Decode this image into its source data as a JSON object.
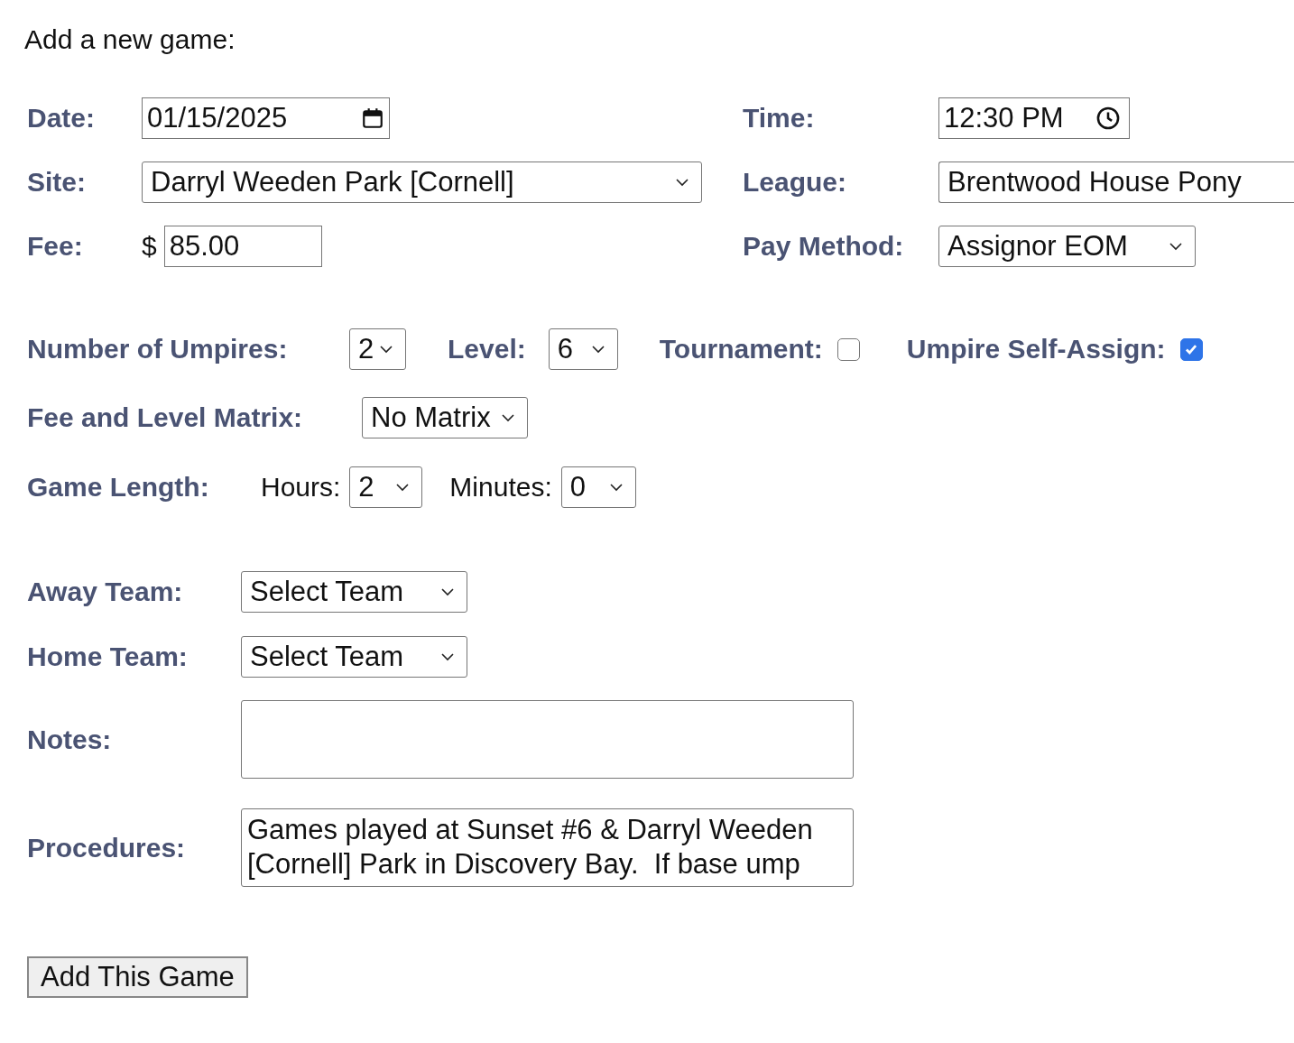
{
  "heading": "Add a new game:",
  "date": {
    "label": "Date:",
    "value": "01/15/2025"
  },
  "time": {
    "label": "Time:",
    "value": "12:30 PM"
  },
  "site": {
    "label": "Site:",
    "value": "Darryl Weeden Park [Cornell]"
  },
  "league": {
    "label": "League:",
    "value": "Brentwood House Pony"
  },
  "fee": {
    "label": "Fee:",
    "currency": "$",
    "value": "85.00"
  },
  "pay_method": {
    "label": "Pay Method:",
    "value": "Assignor EOM"
  },
  "umpires": {
    "label": "Number of Umpires:",
    "value": "2"
  },
  "level": {
    "label": "Level:",
    "value": "6"
  },
  "tournament": {
    "label": "Tournament:",
    "checked": false
  },
  "self_assign": {
    "label": "Umpire Self-Assign:",
    "checked": true
  },
  "matrix": {
    "label": "Fee and Level Matrix:",
    "value": "No Matrix"
  },
  "game_length": {
    "label": "Game Length:",
    "hours": {
      "label": "Hours:",
      "value": "2"
    },
    "minutes": {
      "label": "Minutes:",
      "value": "0"
    }
  },
  "away_team": {
    "label": "Away Team:",
    "value": "Select Team"
  },
  "home_team": {
    "label": "Home Team:",
    "value": "Select Team"
  },
  "notes": {
    "label": "Notes:"
  },
  "procedures": {
    "label": "Procedures:",
    "value": "Games played at Sunset #6 & Darryl Weeden [Cornell] Park in Discovery Bay.  If base ump"
  },
  "submit_button": "Add This Game"
}
